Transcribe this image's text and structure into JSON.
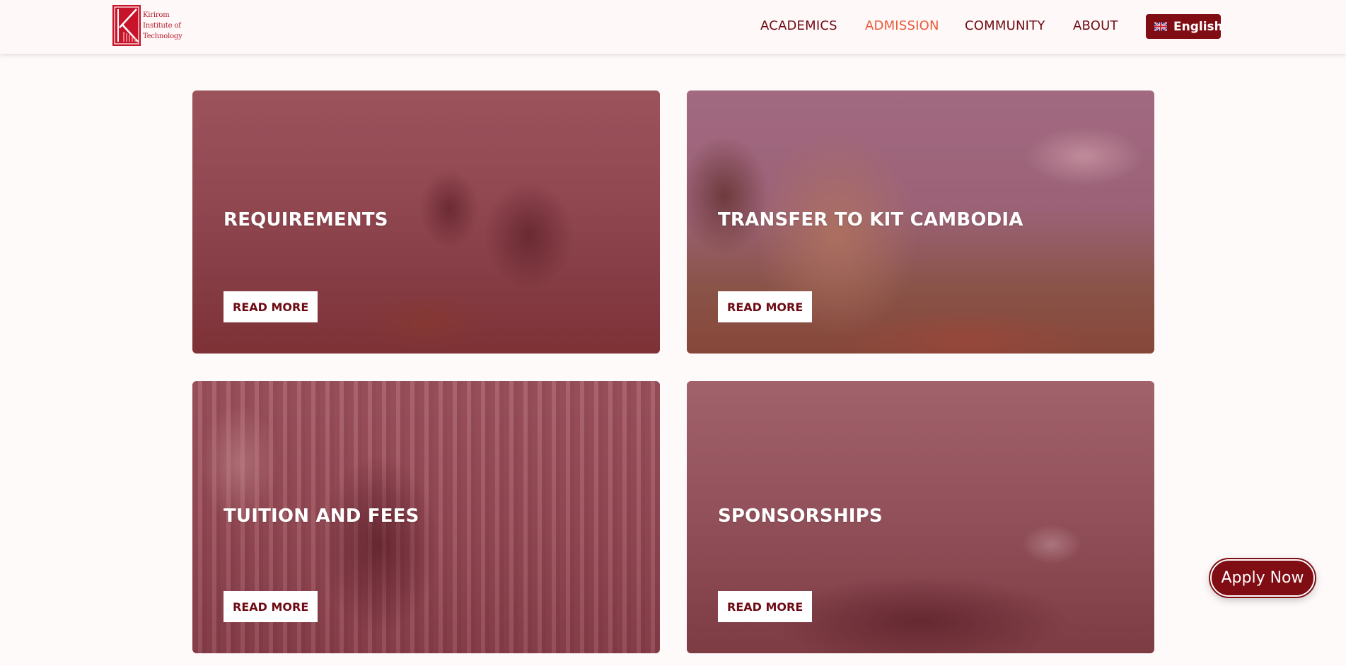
{
  "header": {
    "logo": {
      "line1": "Kirirom",
      "line2": "Institute of",
      "line3": "Technology",
      "color": "#b3192a"
    },
    "nav": [
      {
        "label": "ACADEMICS",
        "active": false
      },
      {
        "label": "ADMISSION",
        "active": true
      },
      {
        "label": "COMMUNITY",
        "active": false
      },
      {
        "label": "ABOUT",
        "active": false
      }
    ],
    "language": {
      "label": "English",
      "icon": "uk-flag-icon"
    }
  },
  "colors": {
    "brand": "#800d14",
    "nav_text": "#6e0b14",
    "nav_active": "#e85a3a",
    "background": "#fffafa"
  },
  "cards": [
    {
      "title": "REQUIREMENTS",
      "cta": "READ MORE",
      "image": "students-group-photo"
    },
    {
      "title": "TRANSFER TO KIT CAMBODIA",
      "cta": "READ MORE",
      "image": "campus-stone-sign"
    },
    {
      "title": "TUITION AND FEES",
      "cta": "READ MORE",
      "image": "library-student-reading"
    },
    {
      "title": "SPONSORSHIPS",
      "cta": "READ MORE",
      "image": "lecture-hall-audience"
    }
  ],
  "apply": {
    "label": "Apply Now"
  }
}
